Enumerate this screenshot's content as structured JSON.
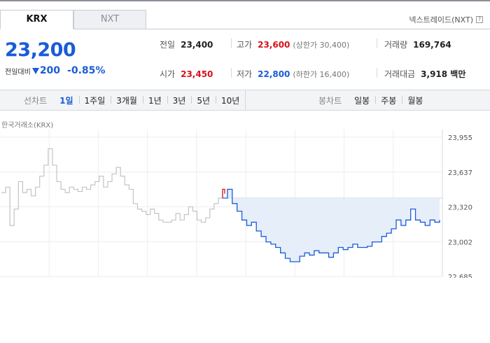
{
  "market_tabs": [
    {
      "label": "KRX",
      "active": true
    },
    {
      "label": "NXT",
      "active": false
    }
  ],
  "nextrade_link": "넥스트레이드(NXT)",
  "help_icon": "question-icon",
  "current_price": "23,200",
  "change": {
    "label": "전일대비",
    "direction_icon": "down-triangle-icon",
    "amount": "200",
    "percent": "-0.85%"
  },
  "stats": {
    "prev_close": {
      "label": "전일",
      "value": "23,400"
    },
    "high": {
      "label": "고가",
      "value": "23,600",
      "sub": "(상한가 30,400)"
    },
    "volume": {
      "label": "거래량",
      "value": "169,764"
    },
    "open": {
      "label": "시가",
      "value": "23,450"
    },
    "low": {
      "label": "저가",
      "value": "22,800",
      "sub": "(하한가 16,400)"
    },
    "trade_amount": {
      "label": "거래대금",
      "value": "3,918 백만"
    }
  },
  "line_chart_tabs": {
    "label": "선차트",
    "items": [
      "1일",
      "1주일",
      "3개월",
      "1년",
      "3년",
      "5년",
      "10년"
    ],
    "active": "1일"
  },
  "candle_chart_tabs": {
    "label": "봉차트",
    "items": [
      "일봉",
      "주봉",
      "월봉"
    ]
  },
  "chart_caption": "한국거래소(KRX)",
  "colors": {
    "down": "#1a5cd7",
    "up": "#d6121b",
    "prev_day_line": "#c4c4c4",
    "fill": "#e3ecf9"
  },
  "chart_data": {
    "type": "line",
    "title": "",
    "ylim": [
      22685,
      23955
    ],
    "y_ticks": [
      "23,955",
      "23,637",
      "23,320",
      "23,002",
      "22,685"
    ],
    "reference_line": 23400,
    "grid": true,
    "series": [
      {
        "role": "previous-day",
        "color": "#c4c4c4",
        "values": [
          23450,
          23500,
          23150,
          23300,
          23550,
          23450,
          23480,
          23420,
          23500,
          23600,
          23700,
          23850,
          23700,
          23550,
          23480,
          23450,
          23500,
          23480,
          23460,
          23500,
          23480,
          23520,
          23550,
          23600,
          23500,
          23550,
          23620,
          23680,
          23600,
          23520,
          23480,
          23350,
          23300,
          23280,
          23250,
          23300,
          23260,
          23200,
          23180,
          23180,
          23200,
          23260,
          23200,
          23250,
          23320,
          23280,
          23200,
          23180,
          23220,
          23300,
          23350,
          23400,
          23450
        ]
      },
      {
        "role": "today",
        "color": "#1a5cd7",
        "values": [
          23400,
          23480,
          23350,
          23280,
          23200,
          23150,
          23180,
          23100,
          23050,
          23000,
          22980,
          22950,
          22900,
          22850,
          22820,
          22820,
          22870,
          22900,
          22880,
          22920,
          22900,
          22900,
          22860,
          22900,
          22950,
          22930,
          22950,
          22980,
          22950,
          22950,
          22960,
          23000,
          23000,
          23050,
          23080,
          23120,
          23200,
          23150,
          23200,
          23300,
          23200,
          23180,
          23150,
          23200,
          23180,
          23200
        ]
      }
    ]
  }
}
